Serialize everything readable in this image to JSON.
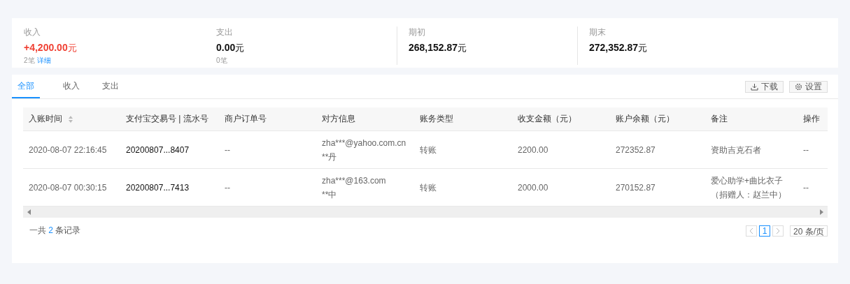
{
  "summary": [
    {
      "label": "收入",
      "value": "+4,200.00",
      "unit": "元",
      "kind": "income",
      "count": "2笔",
      "link": "详细"
    },
    {
      "label": "支出",
      "value": "0.00",
      "unit": "元",
      "kind": "plain",
      "count": "0笔"
    },
    {
      "label": "期初",
      "value": "268,152.87",
      "unit": "元",
      "kind": "plain"
    },
    {
      "label": "期末",
      "value": "272,352.87",
      "unit": "元",
      "kind": "plain"
    }
  ],
  "tabs": [
    {
      "label": "全部",
      "selected": true
    },
    {
      "label": "收入",
      "selected": false
    },
    {
      "label": "支出",
      "selected": false
    }
  ],
  "toolbar": {
    "download": "下载",
    "settings": "设置"
  },
  "table": {
    "columns": [
      {
        "label": "入账时间",
        "sortable": true
      },
      {
        "label": "支付宝交易号 | 流水号",
        "sortable": false
      },
      {
        "label": "商户订单号",
        "sortable": false
      },
      {
        "label": "对方信息",
        "sortable": false
      },
      {
        "label": "账务类型",
        "sortable": false
      },
      {
        "label": "收支金额（元）",
        "sortable": false
      },
      {
        "label": "账户余额（元）",
        "sortable": false
      },
      {
        "label": "备注",
        "sortable": false
      },
      {
        "label": "操作",
        "sortable": false
      }
    ],
    "rows": [
      {
        "cells": [
          "2020-08-07 22:16:45",
          "20200807...8407",
          "--",
          "zha***@yahoo.com.cn\n**丹",
          "转账",
          "2200.00",
          "272352.87",
          "资助吉克石者",
          "--"
        ]
      },
      {
        "cells": [
          "2020-08-07 00:30:15",
          "20200807...7413",
          "--",
          "zha***@163.com\n**中",
          "转账",
          "2000.00",
          "270152.87",
          "爱心助学+曲比衣子（捐赠人：赵兰中）",
          "--"
        ]
      }
    ]
  },
  "footer": {
    "prefix": "一共",
    "count": "2",
    "suffix": "条记录"
  },
  "pagination": {
    "pages": [
      {
        "label": "1",
        "selected": true
      }
    ],
    "page_size": "20 条/页"
  }
}
